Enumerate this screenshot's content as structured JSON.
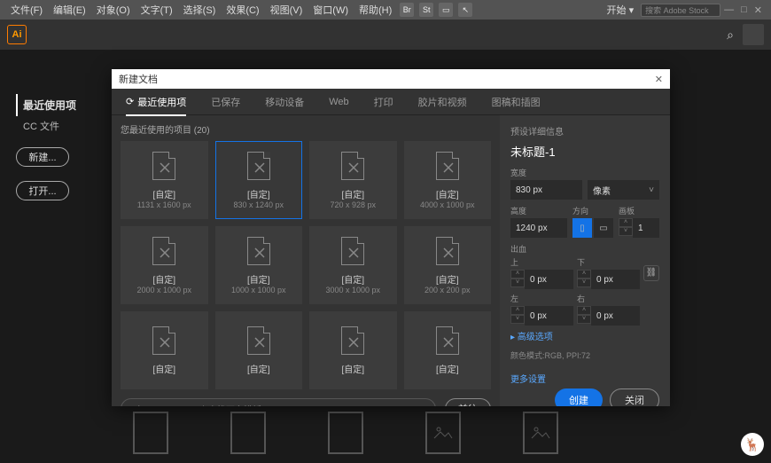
{
  "menu": [
    "文件(F)",
    "编辑(E)",
    "对象(O)",
    "文字(T)",
    "选择(S)",
    "效果(C)",
    "视图(V)",
    "窗口(W)",
    "帮助(H)"
  ],
  "top_start": "开始 ▾",
  "top_search_ph": "搜索 Adobe Stock",
  "sidebar": {
    "active": "最近使用项",
    "sub": "CC 文件",
    "new_btn": "新建...",
    "open_btn": "打开..."
  },
  "modal": {
    "title": "新建文档",
    "tabs": [
      "最近使用项",
      "已保存",
      "移动设备",
      "Web",
      "打印",
      "胶片和视频",
      "图稿和插图"
    ],
    "active_tab": 0,
    "recent_header": "您最近使用的项目",
    "recent_count": "(20)",
    "cards": [
      {
        "label": "[自定]",
        "dim": "1131 x 1600 px"
      },
      {
        "label": "[自定]",
        "dim": "830 x 1240 px"
      },
      {
        "label": "[自定]",
        "dim": "720 x 928 px"
      },
      {
        "label": "[自定]",
        "dim": "4000 x 1000 px"
      },
      {
        "label": "[自定]",
        "dim": "2000 x 1000 px"
      },
      {
        "label": "[自定]",
        "dim": "1000 x 1000 px"
      },
      {
        "label": "[自定]",
        "dim": "3000 x 1000 px"
      },
      {
        "label": "[自定]",
        "dim": "200 x 200 px"
      },
      {
        "label": "[自定]",
        "dim": ""
      },
      {
        "label": "[自定]",
        "dim": ""
      },
      {
        "label": "[自定]",
        "dim": ""
      },
      {
        "label": "[自定]",
        "dim": ""
      }
    ],
    "selected_card": 1,
    "stock_ph": "在 Adobe Stock 上查找更多模板",
    "go": "前往"
  },
  "panel": {
    "header": "预设详细信息",
    "name": "未标题-1",
    "width_lbl": "宽度",
    "width_val": "830 px",
    "unit": "像素",
    "height_lbl": "高度",
    "height_val": "1240 px",
    "orient_lbl": "方向",
    "artboard_lbl": "画板",
    "artboard_val": "1",
    "bleed_lbl": "出血",
    "bleed": {
      "top": "上",
      "top_v": "0 px",
      "bottom": "下",
      "bottom_v": "0 px",
      "left": "左",
      "left_v": "0 px",
      "right": "右",
      "right_v": "0 px"
    },
    "adv": "▸ 高级选项",
    "mode": "颜色模式:RGB, PPI:72",
    "more": "更多设置",
    "create": "创建",
    "close": "关闭"
  }
}
